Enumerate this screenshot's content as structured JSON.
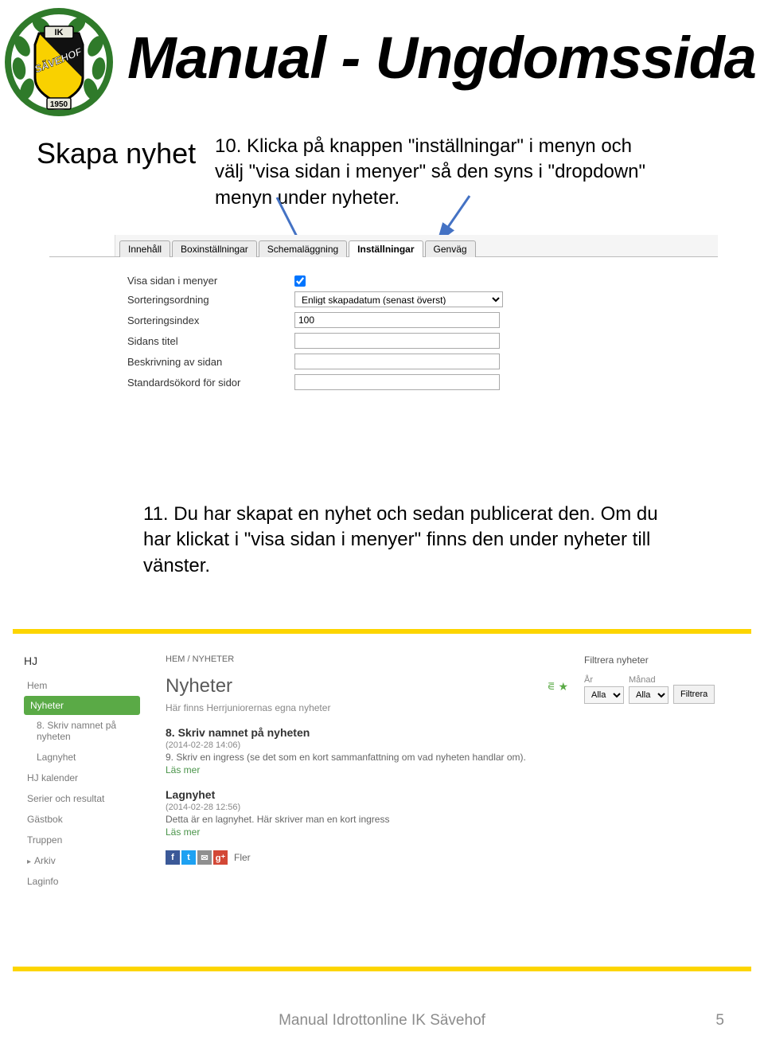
{
  "header": {
    "title": "Manual - Ungdomssida",
    "logo": {
      "club": "IK",
      "name": "SÄVEHOF",
      "year": "1950"
    }
  },
  "section_title": "Skapa nyhet",
  "para1": "10. Klicka på knappen \"inställningar\" i menyn och välj \"visa sidan i menyer\" så den syns i \"dropdown\" menyn under nyheter.",
  "settings_panel": {
    "tabs": [
      "Innehåll",
      "Boxinställningar",
      "Schemaläggning",
      "Inställningar",
      "Genväg"
    ],
    "active_tab": 3,
    "fields": {
      "visa_label": "Visa sidan i menyer",
      "visa_checked": true,
      "sortering_label": "Sorteringsordning",
      "sortering_value": "Enligt skapadatum (senast överst)",
      "index_label": "Sorteringsindex",
      "index_value": "100",
      "titel_label": "Sidans titel",
      "titel_value": "",
      "beskr_label": "Beskrivning av sidan",
      "beskr_value": "",
      "sokord_label": "Standardsökord för sidor",
      "sokord_value": ""
    }
  },
  "para2": "11. Du har skapat en nyhet och sedan publicerat den. Om du har klickat i \"visa sidan i menyer\" finns den under nyheter till vänster.",
  "site_panel": {
    "sidebar_title": "HJ",
    "sidebar_items": [
      {
        "label": "Hem"
      },
      {
        "label": "Nyheter",
        "active": true
      },
      {
        "label": "8. Skriv namnet på nyheten",
        "sub": true
      },
      {
        "label": "Lagnyhet",
        "sub": true
      },
      {
        "label": "HJ kalender"
      },
      {
        "label": "Serier och resultat"
      },
      {
        "label": "Gästbok"
      },
      {
        "label": "Truppen"
      },
      {
        "label": "Arkiv",
        "arrowed": true
      },
      {
        "label": "Laginfo"
      }
    ],
    "breadcrumb": "HEM / NYHETER",
    "page_title": "Nyheter",
    "page_subtext": "Här finns Herrjuniorernas egna nyheter",
    "news": [
      {
        "title": "8. Skriv namnet på nyheten",
        "date": "(2014-02-28 14:06)",
        "body": "9. Skriv en ingress (se det som en kort sammanfattning om vad nyheten handlar om).",
        "more": "Läs mer"
      },
      {
        "title": "Lagnyhet",
        "date": "(2014-02-28 12:56)",
        "body": "Detta är en lagnyhet. Här skriver man en kort ingress",
        "more": "Läs mer"
      }
    ],
    "share_more": "Fler",
    "filter": {
      "title": "Filtrera nyheter",
      "year_label": "År",
      "year_value": "Alla",
      "month_label": "Månad",
      "month_value": "Alla",
      "button": "Filtrera"
    }
  },
  "footer": "Manual Idrottonline IK Sävehof",
  "page_number": "5"
}
